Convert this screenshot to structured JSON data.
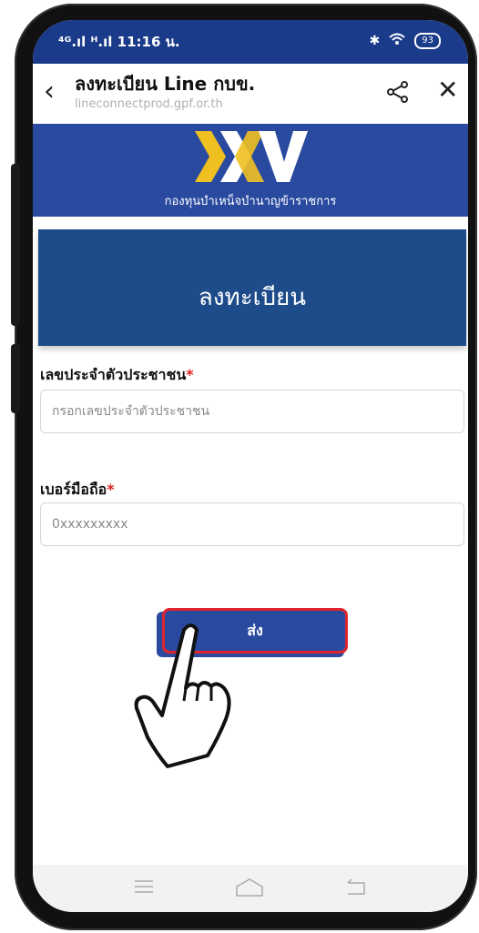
{
  "status_bar": {
    "left_text": "⁴ᴳ.ıl ᴴ.ıl 11:16 น.",
    "battery": "93"
  },
  "browser": {
    "title": "ลงทะเบียน Line กบข.",
    "url": "lineconnectprod.gpf.or.th"
  },
  "banner": {
    "logo_text": "XXV",
    "org_name": "กองทุนบำเหน็จบำนาญข้าราชการ"
  },
  "form": {
    "heading": "ลงทะเบียน",
    "id_label": "เลขประจำตัวประชาชน",
    "id_placeholder": "กรอกเลขประจำตัวประชาชน",
    "phone_label": "เบอร์มือถือ",
    "phone_placeholder": "0xxxxxxxxx",
    "required_mark": "*",
    "submit_label": "ส่ง"
  },
  "colors": {
    "status_bar": "#1a3a8a",
    "banner": "#2a4aa0",
    "heading_card": "#1e4b8a",
    "required": "#e02020",
    "highlight": "#e0242e",
    "logo_gold": "#f0c020"
  },
  "icons": [
    "back-icon",
    "share-icon",
    "close-icon",
    "menu-icon",
    "home-icon",
    "return-icon",
    "hand-pointer-icon"
  ]
}
